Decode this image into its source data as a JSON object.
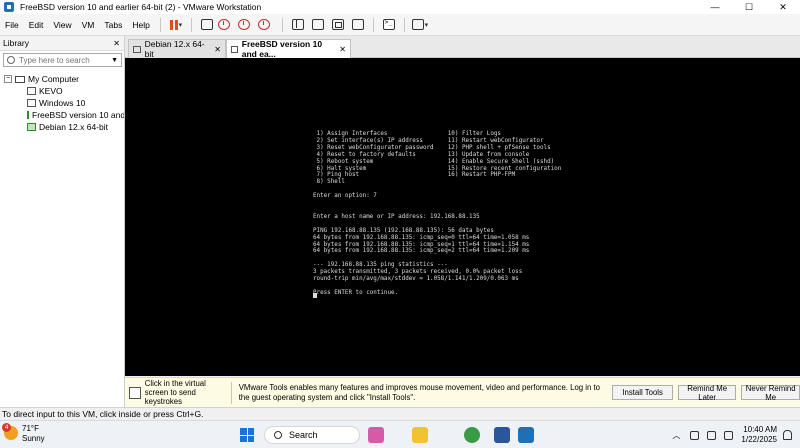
{
  "window": {
    "title": "FreeBSD version 10 and earlier 64-bit (2) - VMware Workstation",
    "controls": [
      "—",
      "☐",
      "✕"
    ]
  },
  "menu": [
    "File",
    "Edit",
    "View",
    "VM",
    "Tabs",
    "Help"
  ],
  "library": {
    "title": "Library",
    "close": "✕",
    "search_placeholder": "Type here to search",
    "root": "My Computer",
    "items": [
      "KEVO",
      "Windows 10",
      "FreeBSD version 10 and e",
      "Debian 12.x 64-bit"
    ]
  },
  "tabs": [
    {
      "label": "Debian 12.x 64-bit"
    },
    {
      "label": "FreeBSD version 10 and ea..."
    }
  ],
  "console": {
    "lines": [
      " 1) Assign Interfaces                 10) Filter Logs",
      " 2) Set interface(s) IP address       11) Restart webConfigurator",
      " 3) Reset webConfigurator password    12) PHP shell + pfSense tools",
      " 4) Reset to factory defaults         13) Update from console",
      " 5) Reboot system                     14) Enable Secure Shell (sshd)",
      " 6) Halt system                       15) Restore recent configuration",
      " 7) Ping host                         16) Restart PHP-FPM",
      " 8) Shell",
      "",
      "Enter an option: 7",
      "",
      "",
      "Enter a host name or IP address: 192.168.88.135",
      "",
      "PING 192.168.88.135 (192.168.88.135): 56 data bytes",
      "64 bytes from 192.168.88.135: icmp_seq=0 ttl=64 time=1.058 ms",
      "64 bytes from 192.168.88.135: icmp_seq=1 ttl=64 time=1.154 ms",
      "64 bytes from 192.168.88.135: icmp_seq=2 ttl=64 time=1.209 ms",
      "",
      "--- 192.168.88.135 ping statistics ---",
      "3 packets transmitted, 3 packets received, 0.0% packet loss",
      "round-trip min/avg/max/stddev = 1.058/1.141/1.209/0.063 ms",
      "",
      "Press ENTER to continue."
    ]
  },
  "hint": {
    "left": "Click in the virtual screen to send keystrokes",
    "message": "VMware Tools enables many features and improves mouse movement, video and performance. Log in to the guest operating system and click \"Install Tools\".",
    "buttons": {
      "install": "Install Tools",
      "remind_later": "Remind Me Later",
      "never": "Never Remind Me"
    }
  },
  "status": "To direct input to this VM, click inside or press Ctrl+G.",
  "taskbar": {
    "weather_badge": "4",
    "temp": "71°F",
    "condition": "Sunny",
    "search_label": "Search",
    "time": "10:40 AM",
    "date": "1/22/2025",
    "apps": [
      {
        "icon": "widgets-icon",
        "color": "#d65aa8"
      },
      {
        "icon": "file-explorer-icon",
        "color": "#f2c230"
      },
      {
        "icon": "chrome-icon",
        "color": "#3a9b47"
      },
      {
        "icon": "word-icon",
        "color": "#2b579a"
      },
      {
        "icon": "vmware-icon",
        "color": "#1f6fb5"
      }
    ]
  }
}
